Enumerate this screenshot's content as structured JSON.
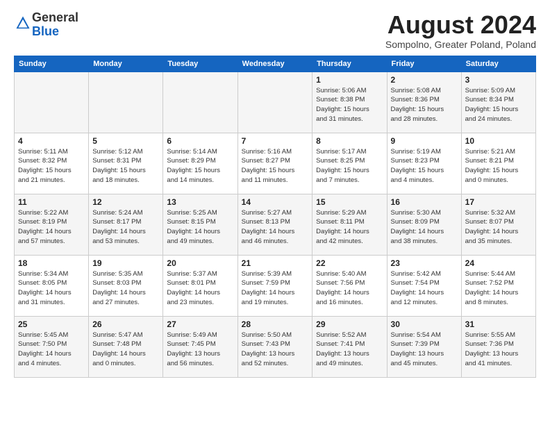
{
  "header": {
    "logo_general": "General",
    "logo_blue": "Blue",
    "month_title": "August 2024",
    "location": "Sompolno, Greater Poland, Poland"
  },
  "weekdays": [
    "Sunday",
    "Monday",
    "Tuesday",
    "Wednesday",
    "Thursday",
    "Friday",
    "Saturday"
  ],
  "weeks": [
    [
      {
        "day": "",
        "info": ""
      },
      {
        "day": "",
        "info": ""
      },
      {
        "day": "",
        "info": ""
      },
      {
        "day": "",
        "info": ""
      },
      {
        "day": "1",
        "info": "Sunrise: 5:06 AM\nSunset: 8:38 PM\nDaylight: 15 hours\nand 31 minutes."
      },
      {
        "day": "2",
        "info": "Sunrise: 5:08 AM\nSunset: 8:36 PM\nDaylight: 15 hours\nand 28 minutes."
      },
      {
        "day": "3",
        "info": "Sunrise: 5:09 AM\nSunset: 8:34 PM\nDaylight: 15 hours\nand 24 minutes."
      }
    ],
    [
      {
        "day": "4",
        "info": "Sunrise: 5:11 AM\nSunset: 8:32 PM\nDaylight: 15 hours\nand 21 minutes."
      },
      {
        "day": "5",
        "info": "Sunrise: 5:12 AM\nSunset: 8:31 PM\nDaylight: 15 hours\nand 18 minutes."
      },
      {
        "day": "6",
        "info": "Sunrise: 5:14 AM\nSunset: 8:29 PM\nDaylight: 15 hours\nand 14 minutes."
      },
      {
        "day": "7",
        "info": "Sunrise: 5:16 AM\nSunset: 8:27 PM\nDaylight: 15 hours\nand 11 minutes."
      },
      {
        "day": "8",
        "info": "Sunrise: 5:17 AM\nSunset: 8:25 PM\nDaylight: 15 hours\nand 7 minutes."
      },
      {
        "day": "9",
        "info": "Sunrise: 5:19 AM\nSunset: 8:23 PM\nDaylight: 15 hours\nand 4 minutes."
      },
      {
        "day": "10",
        "info": "Sunrise: 5:21 AM\nSunset: 8:21 PM\nDaylight: 15 hours\nand 0 minutes."
      }
    ],
    [
      {
        "day": "11",
        "info": "Sunrise: 5:22 AM\nSunset: 8:19 PM\nDaylight: 14 hours\nand 57 minutes."
      },
      {
        "day": "12",
        "info": "Sunrise: 5:24 AM\nSunset: 8:17 PM\nDaylight: 14 hours\nand 53 minutes."
      },
      {
        "day": "13",
        "info": "Sunrise: 5:25 AM\nSunset: 8:15 PM\nDaylight: 14 hours\nand 49 minutes."
      },
      {
        "day": "14",
        "info": "Sunrise: 5:27 AM\nSunset: 8:13 PM\nDaylight: 14 hours\nand 46 minutes."
      },
      {
        "day": "15",
        "info": "Sunrise: 5:29 AM\nSunset: 8:11 PM\nDaylight: 14 hours\nand 42 minutes."
      },
      {
        "day": "16",
        "info": "Sunrise: 5:30 AM\nSunset: 8:09 PM\nDaylight: 14 hours\nand 38 minutes."
      },
      {
        "day": "17",
        "info": "Sunrise: 5:32 AM\nSunset: 8:07 PM\nDaylight: 14 hours\nand 35 minutes."
      }
    ],
    [
      {
        "day": "18",
        "info": "Sunrise: 5:34 AM\nSunset: 8:05 PM\nDaylight: 14 hours\nand 31 minutes."
      },
      {
        "day": "19",
        "info": "Sunrise: 5:35 AM\nSunset: 8:03 PM\nDaylight: 14 hours\nand 27 minutes."
      },
      {
        "day": "20",
        "info": "Sunrise: 5:37 AM\nSunset: 8:01 PM\nDaylight: 14 hours\nand 23 minutes."
      },
      {
        "day": "21",
        "info": "Sunrise: 5:39 AM\nSunset: 7:59 PM\nDaylight: 14 hours\nand 19 minutes."
      },
      {
        "day": "22",
        "info": "Sunrise: 5:40 AM\nSunset: 7:56 PM\nDaylight: 14 hours\nand 16 minutes."
      },
      {
        "day": "23",
        "info": "Sunrise: 5:42 AM\nSunset: 7:54 PM\nDaylight: 14 hours\nand 12 minutes."
      },
      {
        "day": "24",
        "info": "Sunrise: 5:44 AM\nSunset: 7:52 PM\nDaylight: 14 hours\nand 8 minutes."
      }
    ],
    [
      {
        "day": "25",
        "info": "Sunrise: 5:45 AM\nSunset: 7:50 PM\nDaylight: 14 hours\nand 4 minutes."
      },
      {
        "day": "26",
        "info": "Sunrise: 5:47 AM\nSunset: 7:48 PM\nDaylight: 14 hours\nand 0 minutes."
      },
      {
        "day": "27",
        "info": "Sunrise: 5:49 AM\nSunset: 7:45 PM\nDaylight: 13 hours\nand 56 minutes."
      },
      {
        "day": "28",
        "info": "Sunrise: 5:50 AM\nSunset: 7:43 PM\nDaylight: 13 hours\nand 52 minutes."
      },
      {
        "day": "29",
        "info": "Sunrise: 5:52 AM\nSunset: 7:41 PM\nDaylight: 13 hours\nand 49 minutes."
      },
      {
        "day": "30",
        "info": "Sunrise: 5:54 AM\nSunset: 7:39 PM\nDaylight: 13 hours\nand 45 minutes."
      },
      {
        "day": "31",
        "info": "Sunrise: 5:55 AM\nSunset: 7:36 PM\nDaylight: 13 hours\nand 41 minutes."
      }
    ]
  ]
}
